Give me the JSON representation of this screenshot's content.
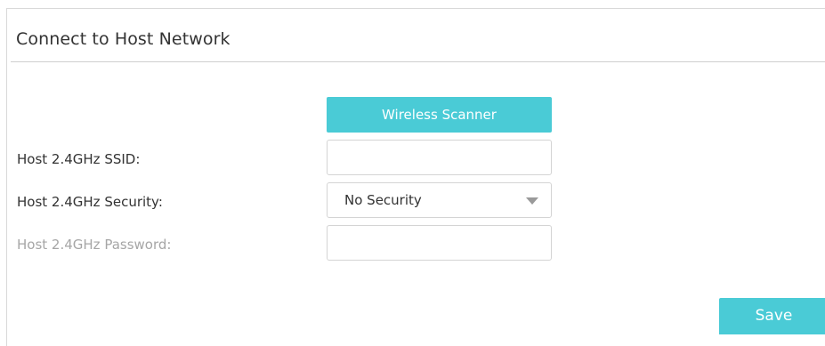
{
  "section": {
    "title": "Connect to Host Network"
  },
  "scanner": {
    "label": "Wireless Scanner"
  },
  "form": {
    "ssid": {
      "label": "Host 2.4GHz SSID:",
      "value": ""
    },
    "security": {
      "label": "Host 2.4GHz Security:",
      "selected": "No Security",
      "icon": "chevron-down-icon"
    },
    "password": {
      "label": "Host 2.4GHz Password:",
      "value": "",
      "disabled": true
    }
  },
  "actions": {
    "save_label": "Save"
  },
  "colors": {
    "accent": "#4acbd6",
    "text": "#333333",
    "disabled_text": "#a6a6a6",
    "border": "#d4d4d4"
  }
}
